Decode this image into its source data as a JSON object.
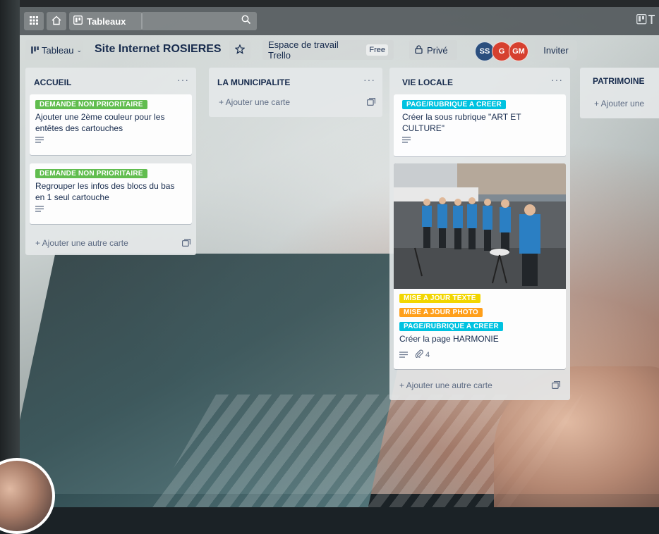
{
  "nav": {
    "boards_label": "Tableaux"
  },
  "board": {
    "view_label": "Tableau",
    "title": "Site Internet ROSIERES",
    "workspace_label": "Espace de travail Trello",
    "workspace_badge": "Free",
    "privacy_label": "Privé",
    "members": [
      {
        "initials": "SS",
        "color": "#2b4f7e"
      },
      {
        "initials": "G",
        "color": "#d6402f"
      },
      {
        "initials": "GM",
        "color": "#d6402f"
      }
    ],
    "invite_label": "Inviter"
  },
  "label_colors": {
    "green": "#61bd4f",
    "blue": "#00c2e0",
    "yellow": "#f2d600",
    "orange": "#ff9f1a"
  },
  "lists": [
    {
      "title": "ACCUEIL",
      "menu": "···",
      "add_card_label": "+ Ajouter une autre carte",
      "cards": [
        {
          "labels": [
            "DEMANDE NON PRIORITAIRE"
          ],
          "text_lines": [
            "Ajouter une 2ème couleur pour les",
            "entêtes des cartouches"
          ]
        },
        {
          "labels": [
            "DEMANDE NON PRIORITAIRE"
          ],
          "text_lines": [
            "Regrouper les infos des blocs du bas",
            "en 1 seul cartouche"
          ]
        }
      ]
    },
    {
      "title": "LA MUNICIPALITE",
      "menu": "···",
      "add_card_label": "+ Ajouter une carte",
      "cards": []
    },
    {
      "title": "VIE LOCALE",
      "menu": "···",
      "add_card_label": "+ Ajouter une autre carte",
      "cards": [
        {
          "labels": [
            "PAGE/RUBRIQUE A CREER"
          ],
          "text_lines": [
            "Créer la sous rubrique \"ART ET",
            "CULTURE\""
          ]
        },
        {
          "labels": [
            "MISE A JOUR TEXTE",
            "MISE A JOUR PHOTO",
            "PAGE/RUBRIQUE A CREER"
          ],
          "text_lines": [
            "Créer la page HARMONIE"
          ],
          "attachments": "4"
        }
      ]
    },
    {
      "title": "PATRIMOINE",
      "add_card_label": "+ Ajouter une",
      "cards": []
    }
  ]
}
